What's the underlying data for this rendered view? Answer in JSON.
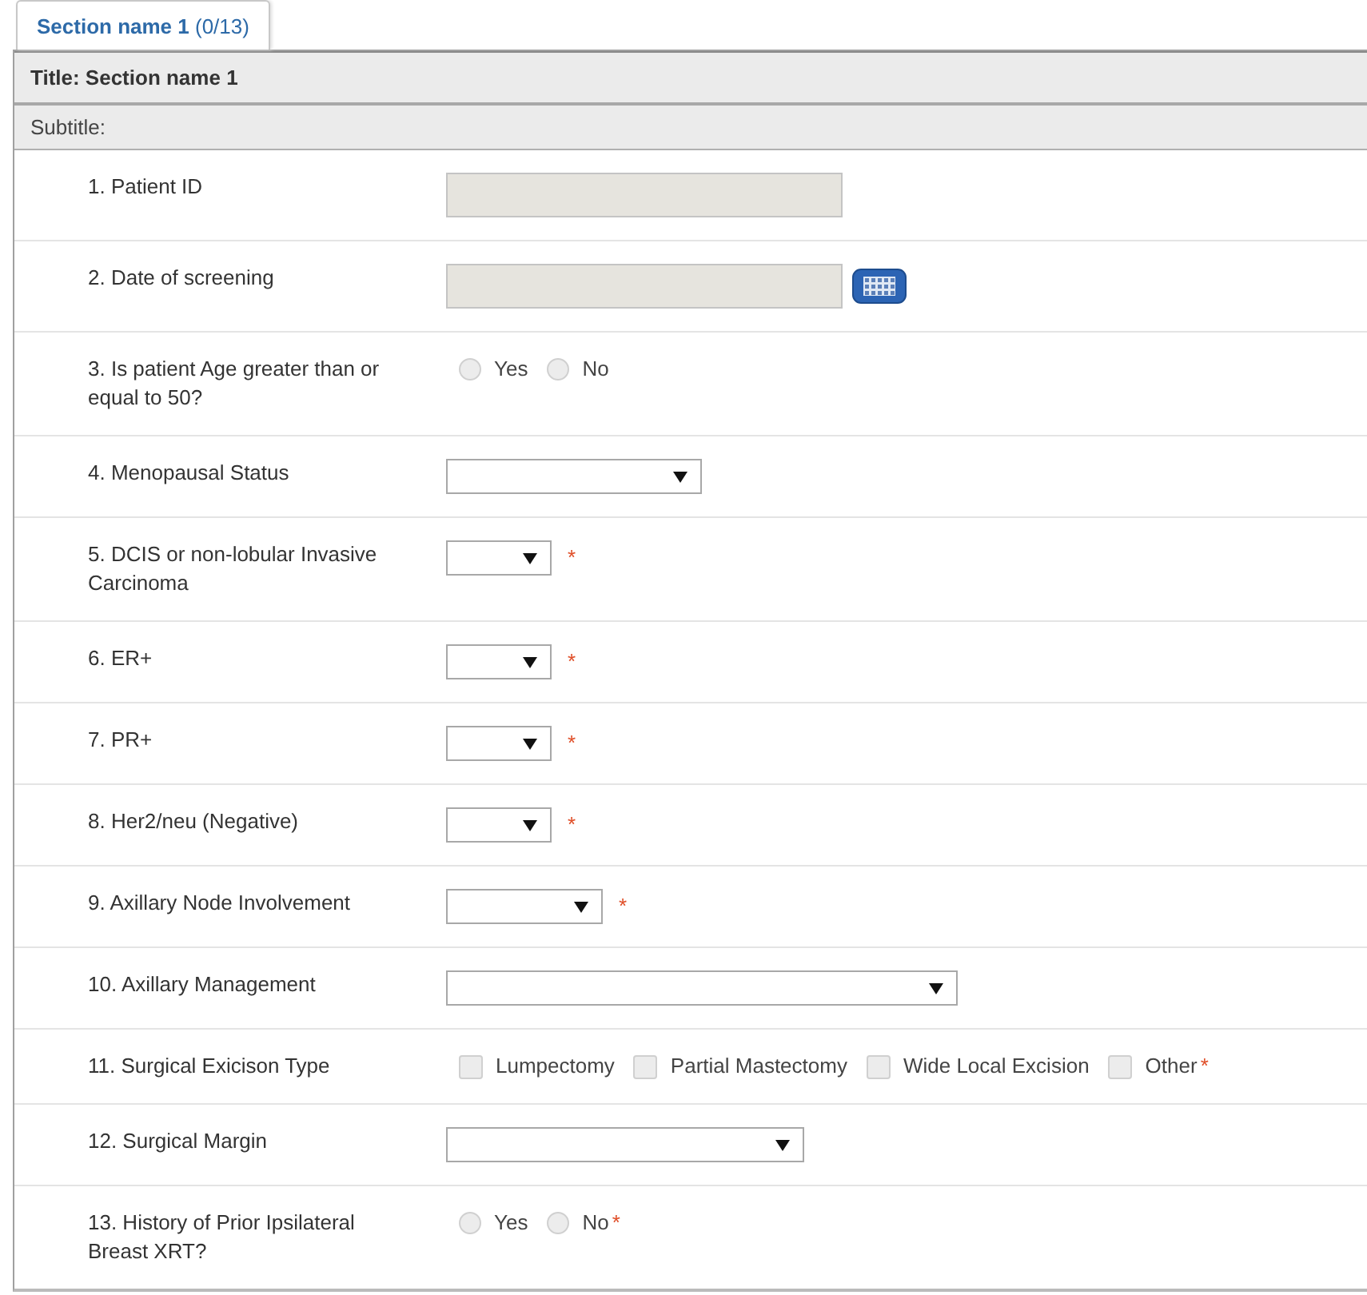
{
  "tab": {
    "label": "Section name 1",
    "count": "(0/13)",
    "selected": true
  },
  "section": {
    "title": "Title: Section name 1",
    "subtitle": "Subtitle:"
  },
  "questions": [
    {
      "label": "1. Patient ID",
      "kind": "text",
      "disabled": true
    },
    {
      "label": "2. Date of screening",
      "kind": "date",
      "disabled": true
    },
    {
      "label": "3. Is patient Age greater than or equal to 50?",
      "kind": "radio",
      "options": [
        {
          "label": "Yes",
          "selected": false
        },
        {
          "label": "No",
          "selected": false
        }
      ]
    },
    {
      "label": "4. Menopausal Status",
      "kind": "select"
    },
    {
      "label": "5. DCIS or non-lobular Invasive Carcinoma",
      "kind": "select",
      "required": "*"
    },
    {
      "label": "6. ER+",
      "kind": "select",
      "required": "*"
    },
    {
      "label": "7. PR+",
      "kind": "select",
      "required": "*"
    },
    {
      "label": "8. Her2/neu (Negative)",
      "kind": "select",
      "required": "*"
    },
    {
      "label": "9. Axillary Node Involvement",
      "kind": "select",
      "required": "*"
    },
    {
      "label": "10. Axillary Management",
      "kind": "select"
    },
    {
      "label": "11. Surgical Exicison Type",
      "kind": "checkbox",
      "options": [
        {
          "label": "Lumpectomy",
          "checked": false
        },
        {
          "label": "Partial Mastectomy",
          "checked": false
        },
        {
          "label": "Wide Local Excision",
          "checked": false
        },
        {
          "label": "Other",
          "checked": false
        }
      ],
      "required": "*"
    },
    {
      "label": "12. Surgical Margin",
      "kind": "select"
    },
    {
      "label": "13. History of Prior Ipsilateral Breast XRT?",
      "kind": "radio",
      "options": [
        {
          "label": "Yes",
          "selected": false
        },
        {
          "label": "No",
          "selected": false
        }
      ],
      "required": "*"
    }
  ]
}
